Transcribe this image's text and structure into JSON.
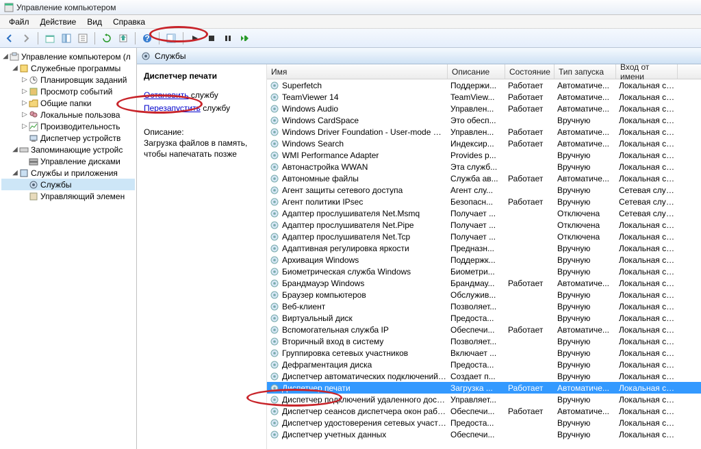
{
  "window": {
    "title": "Управление компьютером"
  },
  "menu": {
    "file": "Файл",
    "action": "Действие",
    "view": "Вид",
    "help": "Справка"
  },
  "tree": {
    "root": "Управление компьютером (л",
    "tools": "Служебные программы",
    "scheduler": "Планировщик заданий",
    "events": "Просмотр событий",
    "shared": "Общие папки",
    "users": "Локальные пользова",
    "perf": "Производительность",
    "devmgr": "Диспетчер устройств",
    "storage": "Запоминающие устройс",
    "diskmgr": "Управление дисками",
    "apps": "Службы и приложения",
    "services": "Службы",
    "wmi": "Управляющий элемен"
  },
  "panel_title": "Службы",
  "detail": {
    "name": "Диспетчер печати",
    "stop_pre": "Остановить",
    "stop_post": " службу",
    "restart_pre": "Перезапустить",
    "restart_post": " службу",
    "desc_label": "Описание:",
    "desc_body": "Загрузка файлов в память, чтобы напечатать позже"
  },
  "columns": {
    "name": "Имя",
    "desc": "Описание",
    "state": "Состояние",
    "start": "Тип запуска",
    "logon": "Вход от имени"
  },
  "services": [
    {
      "n": "Superfetch",
      "d": "Поддержи...",
      "s": "Работает",
      "t": "Автоматиче...",
      "l": "Локальная сис..."
    },
    {
      "n": "TeamViewer 14",
      "d": "TeamView...",
      "s": "Работает",
      "t": "Автоматиче...",
      "l": "Локальная сис..."
    },
    {
      "n": "Windows Audio",
      "d": "Управлен...",
      "s": "Работает",
      "t": "Автоматиче...",
      "l": "Локальная слу..."
    },
    {
      "n": "Windows CardSpace",
      "d": "Это обесп...",
      "s": "",
      "t": "Вручную",
      "l": "Локальная сис..."
    },
    {
      "n": "Windows Driver Foundation - User-mode Driver Fra...",
      "d": "Управлен...",
      "s": "Работает",
      "t": "Автоматиче...",
      "l": "Локальная сис..."
    },
    {
      "n": "Windows Search",
      "d": "Индексир...",
      "s": "Работает",
      "t": "Автоматиче...",
      "l": "Локальная сис..."
    },
    {
      "n": "WMI Performance Adapter",
      "d": "Provides p...",
      "s": "",
      "t": "Вручную",
      "l": "Локальная сис..."
    },
    {
      "n": "Автонастройка WWAN",
      "d": "Эта служб...",
      "s": "",
      "t": "Вручную",
      "l": "Локальная слу..."
    },
    {
      "n": "Автономные файлы",
      "d": "Служба ав...",
      "s": "Работает",
      "t": "Автоматиче...",
      "l": "Локальная сис..."
    },
    {
      "n": "Агент защиты сетевого доступа",
      "d": "Агент слу...",
      "s": "",
      "t": "Вручную",
      "l": "Сетевая служба"
    },
    {
      "n": "Агент политики IPsec",
      "d": "Безопасн...",
      "s": "Работает",
      "t": "Вручную",
      "l": "Сетевая служба"
    },
    {
      "n": "Адаптер прослушивателя Net.Msmq",
      "d": "Получает ...",
      "s": "",
      "t": "Отключена",
      "l": "Сетевая служба"
    },
    {
      "n": "Адаптер прослушивателя Net.Pipe",
      "d": "Получает ...",
      "s": "",
      "t": "Отключена",
      "l": "Локальная слу..."
    },
    {
      "n": "Адаптер прослушивателя Net.Tcp",
      "d": "Получает ...",
      "s": "",
      "t": "Отключена",
      "l": "Локальная слу..."
    },
    {
      "n": "Адаптивная регулировка яркости",
      "d": "Предназн...",
      "s": "",
      "t": "Вручную",
      "l": "Локальная слу..."
    },
    {
      "n": "Архивация Windows",
      "d": "Поддержк...",
      "s": "",
      "t": "Вручную",
      "l": "Локальная сис..."
    },
    {
      "n": "Биометрическая служба Windows",
      "d": "Биометри...",
      "s": "",
      "t": "Вручную",
      "l": "Локальная сис..."
    },
    {
      "n": "Брандмауэр Windows",
      "d": "Брандмау...",
      "s": "Работает",
      "t": "Автоматиче...",
      "l": "Локальная слу..."
    },
    {
      "n": "Браузер компьютеров",
      "d": "Обслужив...",
      "s": "",
      "t": "Вручную",
      "l": "Локальная сис..."
    },
    {
      "n": "Веб-клиент",
      "d": "Позволяет...",
      "s": "",
      "t": "Вручную",
      "l": "Локальная слу..."
    },
    {
      "n": "Виртуальный диск",
      "d": "Предоста...",
      "s": "",
      "t": "Вручную",
      "l": "Локальная сис..."
    },
    {
      "n": "Вспомогательная служба IP",
      "d": "Обеспечи...",
      "s": "Работает",
      "t": "Автоматиче...",
      "l": "Локальная сис..."
    },
    {
      "n": "Вторичный вход в систему",
      "d": "Позволяет...",
      "s": "",
      "t": "Вручную",
      "l": "Локальная сис..."
    },
    {
      "n": "Группировка сетевых участников",
      "d": "Включает ...",
      "s": "",
      "t": "Вручную",
      "l": "Локальная слу..."
    },
    {
      "n": "Дефрагментация диска",
      "d": "Предоста...",
      "s": "",
      "t": "Вручную",
      "l": "Локальная сис..."
    },
    {
      "n": "Диспетчер автоматических подключений удален...",
      "d": "Создает п...",
      "s": "",
      "t": "Вручную",
      "l": "Локальная сис..."
    },
    {
      "n": "Диспетчер печати",
      "d": "Загрузка ...",
      "s": "Работает",
      "t": "Автоматиче...",
      "l": "Локальная сис...",
      "sel": true
    },
    {
      "n": "Диспетчер подключений удаленного доступа",
      "d": "Управляет...",
      "s": "",
      "t": "Вручную",
      "l": "Локальная сис..."
    },
    {
      "n": "Диспетчер сеансов диспетчера окон рабочего с...",
      "d": "Обеспечи...",
      "s": "Работает",
      "t": "Автоматиче...",
      "l": "Локальная сис..."
    },
    {
      "n": "Диспетчер удостоверения сетевых участников",
      "d": "Предоста...",
      "s": "",
      "t": "Вручную",
      "l": "Локальная слу..."
    },
    {
      "n": "Диспетчер учетных данных",
      "d": "Обеспечи...",
      "s": "",
      "t": "Вручную",
      "l": "Локальная сис..."
    }
  ]
}
